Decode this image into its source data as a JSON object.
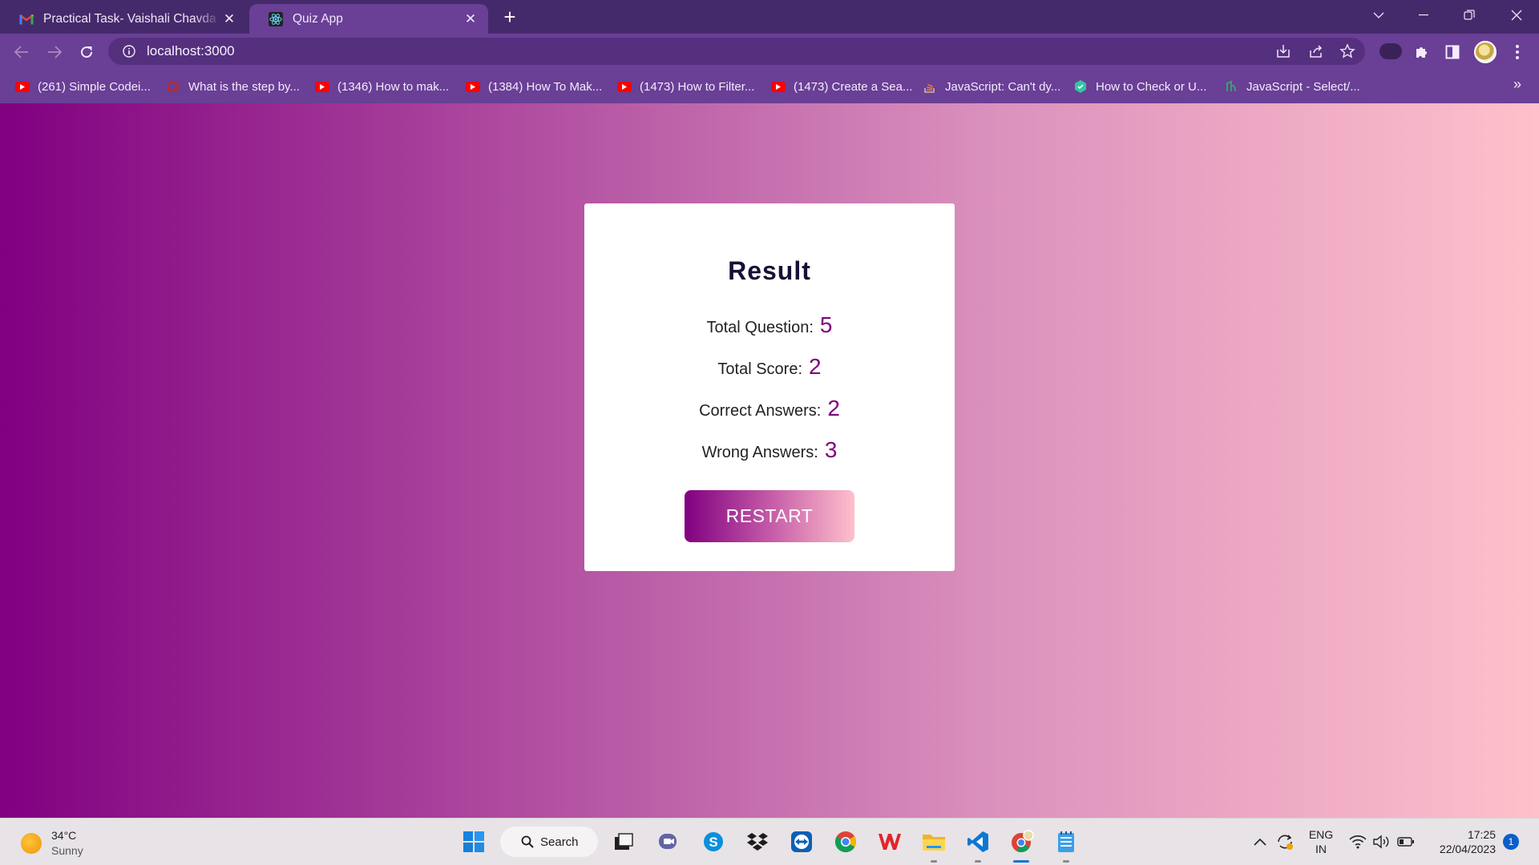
{
  "browser": {
    "tabs": [
      {
        "title": "Practical Task- Vaishali Chavda - V",
        "favicon": "gmail-icon",
        "active": false
      },
      {
        "title": "Quiz App",
        "favicon": "react-icon",
        "active": true
      }
    ],
    "address": "localhost:3000",
    "bookmarks": [
      {
        "label": "(261) Simple Codei...",
        "icon": "youtube-icon"
      },
      {
        "label": "What is the step by...",
        "icon": "quora-icon"
      },
      {
        "label": "(1346) How to mak...",
        "icon": "youtube-icon"
      },
      {
        "label": "(1384) How To Mak...",
        "icon": "youtube-icon"
      },
      {
        "label": "(1473) How to Filter...",
        "icon": "youtube-icon"
      },
      {
        "label": "(1473) Create a Sea...",
        "icon": "youtube-icon"
      },
      {
        "label": "JavaScript: Can't dy...",
        "icon": "stackoverflow-icon"
      },
      {
        "label": "How to Check or U...",
        "icon": "bookmark-shield-icon"
      },
      {
        "label": "JavaScript - Select/...",
        "icon": "bookmark-site-icon"
      }
    ],
    "more_bookmarks": "»"
  },
  "result": {
    "heading": "Result",
    "total_question_label": "Total Question:",
    "total_question": "5",
    "total_score_label": "Total Score:",
    "total_score": "2",
    "correct_label": "Correct Answers:",
    "correct": "2",
    "wrong_label": "Wrong Answers:",
    "wrong": "3",
    "restart_label": "RESTART"
  },
  "colors": {
    "gradient_start": "#800080",
    "gradient_end": "#ffc0cb",
    "value_color": "#800080"
  },
  "taskbar": {
    "temperature": "34°C",
    "condition": "Sunny",
    "search_label": "Search",
    "language_top": "ENG",
    "language_bottom": "IN",
    "time": "17:25",
    "date": "22/04/2023",
    "notifications": "1"
  }
}
